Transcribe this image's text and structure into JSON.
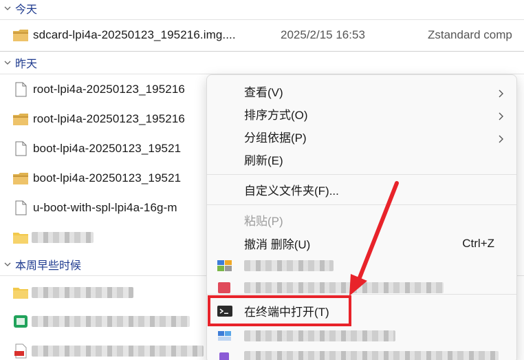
{
  "groups": {
    "today": "今天",
    "yesterday": "昨天",
    "this_week": "本周早些时候"
  },
  "today_files": [
    {
      "name": "sdcard-lpi4a-20250123_195216.img....",
      "date": "2025/2/15 16:53",
      "type": "Zstandard comp",
      "icon": "archive-icon"
    }
  ],
  "yesterday_files": [
    {
      "name": "root-lpi4a-20250123_195216",
      "icon": "file-icon"
    },
    {
      "name": "root-lpi4a-20250123_195216",
      "icon": "archive-icon"
    },
    {
      "name": "boot-lpi4a-20250123_19521",
      "icon": "file-icon"
    },
    {
      "name": "boot-lpi4a-20250123_19521",
      "icon": "archive-icon"
    },
    {
      "name": "u-boot-with-spl-lpi4a-16g-m",
      "icon": "file-icon"
    }
  ],
  "context_menu": {
    "view": "查看(V)",
    "sort": "排序方式(O)",
    "group": "分组依据(P)",
    "refresh": "刷新(E)",
    "customize": "自定义文件夹(F)...",
    "paste": "粘贴(P)",
    "undo": "撤消 删除(U)",
    "undo_shortcut": "Ctrl+Z",
    "terminal": "在终端中打开(T)"
  },
  "colors": {
    "accent_header": "#1f3b8f",
    "highlight_red": "#e8232a",
    "folder_yellow": "#e8b84a"
  }
}
